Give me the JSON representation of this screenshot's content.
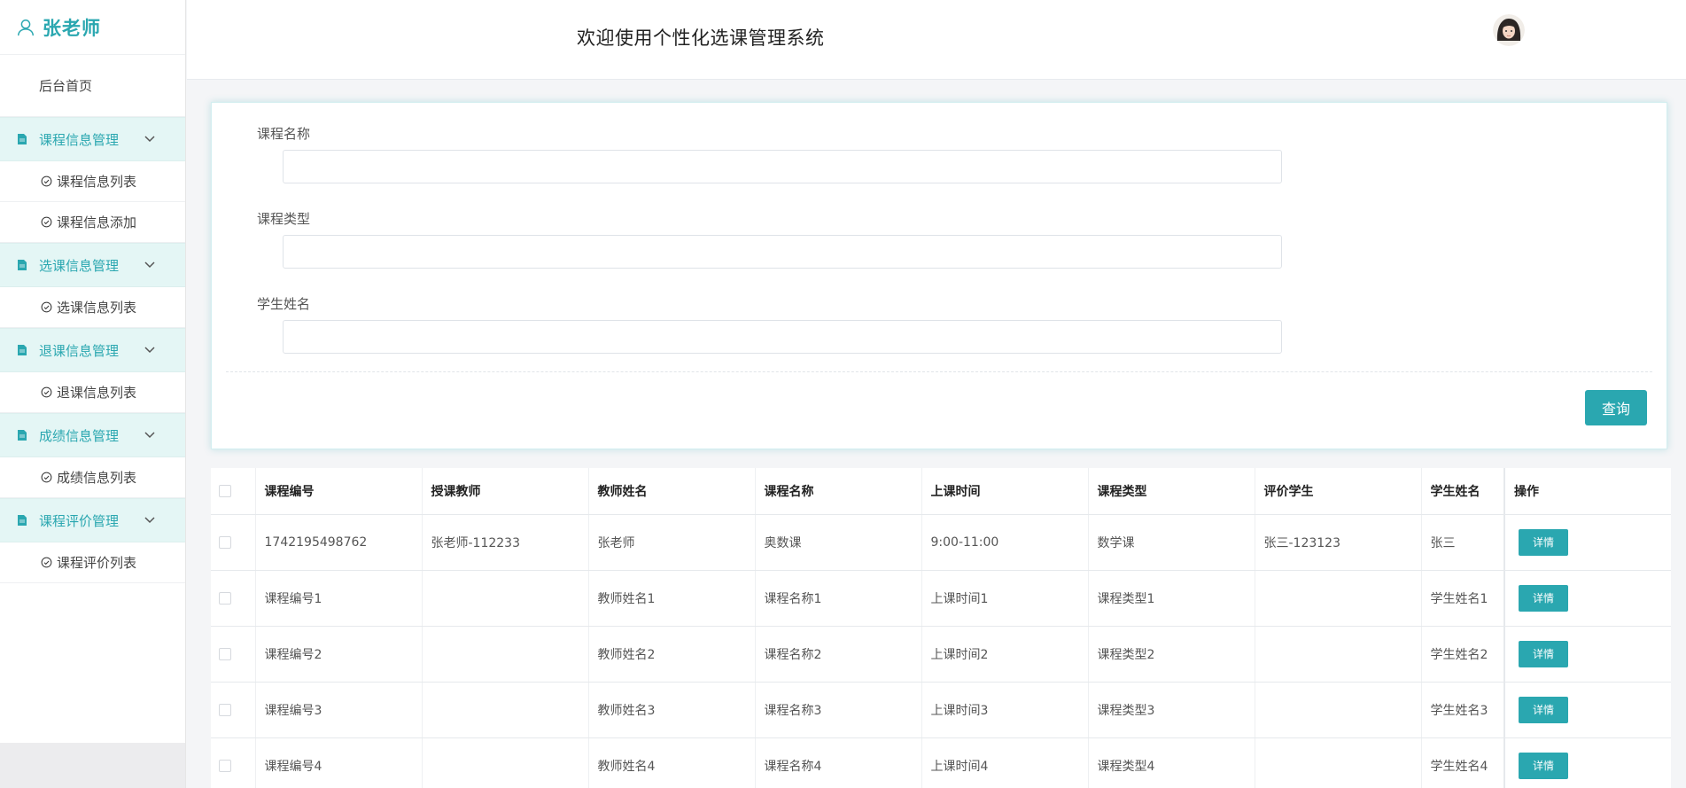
{
  "sidebar": {
    "brand_name": "张老师",
    "home": "后台首页",
    "groups": [
      {
        "label": "课程信息管理",
        "items": [
          "课程信息列表",
          "课程信息添加"
        ]
      },
      {
        "label": "选课信息管理",
        "items": [
          "选课信息列表"
        ]
      },
      {
        "label": "退课信息管理",
        "items": [
          "退课信息列表"
        ]
      },
      {
        "label": "成绩信息管理",
        "items": [
          "成绩信息列表"
        ]
      },
      {
        "label": "课程评价管理",
        "items": [
          "课程评价列表"
        ]
      }
    ]
  },
  "header": {
    "title": "欢迎使用个性化选课管理系统"
  },
  "search": {
    "course_name_label": "课程名称",
    "course_name_value": "",
    "course_type_label": "课程类型",
    "course_type_value": "",
    "student_name_label": "学生姓名",
    "student_name_value": "",
    "query_button": "查询"
  },
  "table": {
    "headers": [
      "课程编号",
      "授课教师",
      "教师姓名",
      "课程名称",
      "上课时间",
      "课程类型",
      "评价学生",
      "学生姓名",
      "操作"
    ],
    "detail_label": "详情",
    "rows": [
      [
        "1742195498762",
        "张老师-112233",
        "张老师",
        "奥数课",
        "9:00-11:00",
        "数学课",
        "张三-123123",
        "张三"
      ],
      [
        "课程编号1",
        "",
        "教师姓名1",
        "课程名称1",
        "上课时间1",
        "课程类型1",
        "",
        "学生姓名1"
      ],
      [
        "课程编号2",
        "",
        "教师姓名2",
        "课程名称2",
        "上课时间2",
        "课程类型2",
        "",
        "学生姓名2"
      ],
      [
        "课程编号3",
        "",
        "教师姓名3",
        "课程名称3",
        "上课时间3",
        "课程类型3",
        "",
        "学生姓名3"
      ],
      [
        "课程编号4",
        "",
        "教师姓名4",
        "课程名称4",
        "上课时间4",
        "课程类型4",
        "",
        "学生姓名4"
      ]
    ]
  },
  "colors": {
    "accent": "#2aa7b0",
    "group_bg": "#e4f6f5"
  }
}
